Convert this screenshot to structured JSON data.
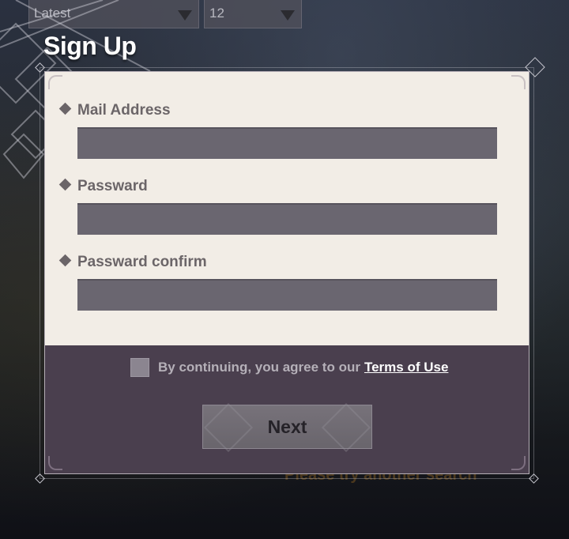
{
  "filters": {
    "sort_value": "Latest",
    "count_value": "12"
  },
  "dialog": {
    "title": "Sign Up",
    "fields": [
      {
        "label": "Mail Address",
        "value": "",
        "placeholder": ""
      },
      {
        "label": "Passward",
        "value": "",
        "placeholder": ""
      },
      {
        "label": "Passward confirm",
        "value": "",
        "placeholder": ""
      }
    ],
    "agree_text": "By continuing, you agree to our",
    "terms_link": "Terms of Use",
    "agree_checked": false,
    "next_label": "Next"
  },
  "background": {
    "message": "Please try another search"
  },
  "colors": {
    "panel_light": "#f2ede6",
    "panel_dark": "#4a3f4e",
    "input": "#6a6670",
    "label": "#6b6568"
  },
  "icons": {
    "field_bullet": "diamond-bullet-icon",
    "dropdown_caret": "caret-down-icon"
  }
}
